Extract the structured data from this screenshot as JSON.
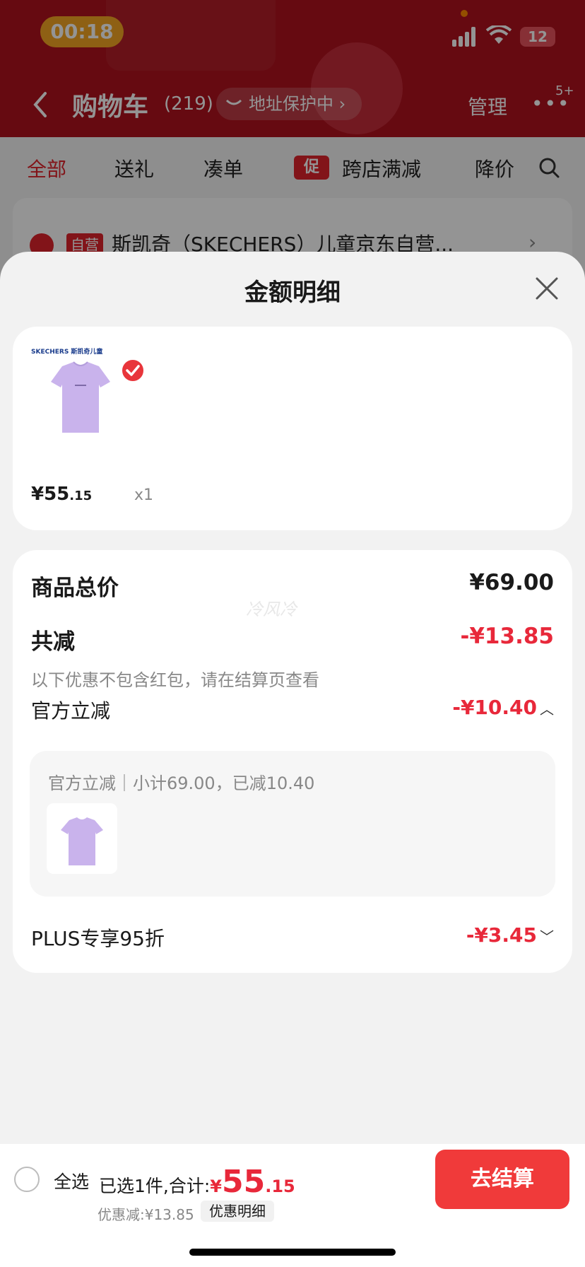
{
  "status_bar": {
    "time": "00:18",
    "battery": "12"
  },
  "header": {
    "title": "购物车",
    "count": "(219)",
    "address_protection": "地址保护中",
    "manage": "管理",
    "more_badge": "5+"
  },
  "tabs": {
    "all": "全部",
    "gift": "送礼",
    "bundle": "凑单",
    "promo_tag": "促",
    "cross_store": "跨店满减",
    "price_drop": "降价"
  },
  "shop": {
    "self_tag": "自营",
    "name": "斯凯奇（SKECHERS）儿童京东自营..."
  },
  "sheet": {
    "title": "金额明细",
    "product": {
      "brand": "SKECHERS 斯凯奇儿童",
      "price_int": "¥55",
      "price_dec": ".15",
      "quantity": "x1"
    },
    "total_label": "商品总价",
    "total_value": "¥69.00",
    "reduce_label": "共减",
    "reduce_value": "-¥13.85",
    "note": "以下优惠不包含红包，请在结算页查看",
    "official_label": "官方立减",
    "official_value": "-¥10.40",
    "official_detail": "官方立减｜小计69.00，已减10.40",
    "plus_label": "PLUS专享95折",
    "plus_value": "-¥3.45",
    "watermark": "冷风冷"
  },
  "bottom_bar": {
    "select_all": "全选",
    "selected_summary": "已选1件,合计:",
    "total_currency": "¥",
    "total_int": "55",
    "total_dec": ".15",
    "discount": "优惠减:¥13.85",
    "discount_detail": "优惠明细",
    "checkout": "去结算"
  },
  "colors": {
    "brand_red": "#e8283a",
    "header_red": "#b0121e",
    "time_pill": "#f5a623"
  }
}
